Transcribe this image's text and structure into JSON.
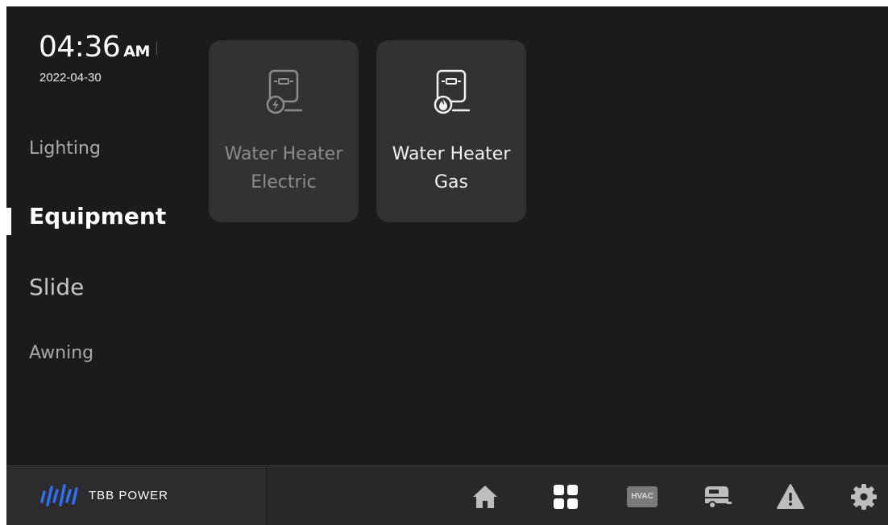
{
  "clock": {
    "time": "04:36",
    "ampm": "AM",
    "date": "2022-04-30"
  },
  "sidebar": {
    "items": [
      {
        "label": "Lighting",
        "active": false
      },
      {
        "label": "Equipment",
        "active": true
      },
      {
        "label": "Slide",
        "active": false
      },
      {
        "label": "Awning",
        "active": false
      }
    ]
  },
  "cards": [
    {
      "line1": "Water Heater",
      "line2": "Electric",
      "icon": "water-heater-electric-icon",
      "enabled": false
    },
    {
      "line1": "Water Heater",
      "line2": "Gas",
      "icon": "water-heater-gas-icon",
      "enabled": true
    }
  ],
  "footer": {
    "brand": "TBB POWER",
    "nav": [
      {
        "icon": "home-icon"
      },
      {
        "icon": "apps-grid-icon",
        "active": true
      },
      {
        "icon": "hvac-icon",
        "label": "HVAC"
      },
      {
        "icon": "rv-trailer-icon"
      },
      {
        "icon": "alert-triangle-icon"
      },
      {
        "icon": "gear-icon"
      }
    ]
  },
  "colors": {
    "background": "#1b1b1b",
    "card": "#323234",
    "active_text": "#ffffff",
    "inactive_text": "#a9a9a9",
    "bottom_bar": "#29292b",
    "brand_blue": "#2f6fff"
  }
}
